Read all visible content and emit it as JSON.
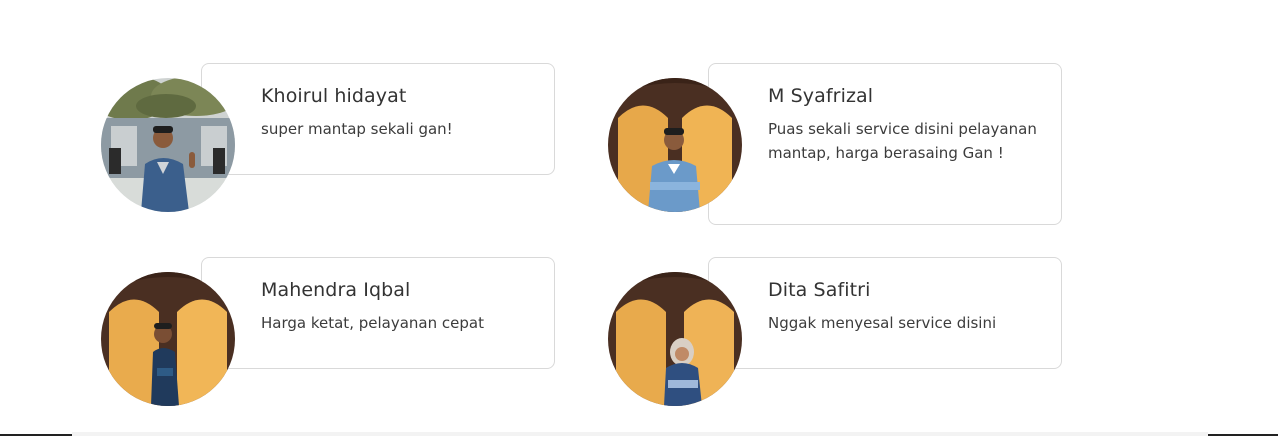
{
  "testimonials": [
    {
      "name": "Khoirul hidayat",
      "review": "super mantap sekali gan!",
      "avatar_icon": "person-photo-icon"
    },
    {
      "name": "M Syafrizal",
      "review": "Puas sekali service disini pelayanan mantap, harga berasaing Gan !",
      "avatar_icon": "person-photo-icon"
    },
    {
      "name": "Mahendra Iqbal",
      "review": "Harga ketat, pelayanan cepat",
      "avatar_icon": "person-photo-icon"
    },
    {
      "name": "Dita Safitri",
      "review": "Nggak menyesal service disini",
      "avatar_icon": "person-photo-icon"
    }
  ],
  "colors": {
    "card_border": "#d9d9d9",
    "text": "#333333",
    "background": "#ffffff"
  }
}
